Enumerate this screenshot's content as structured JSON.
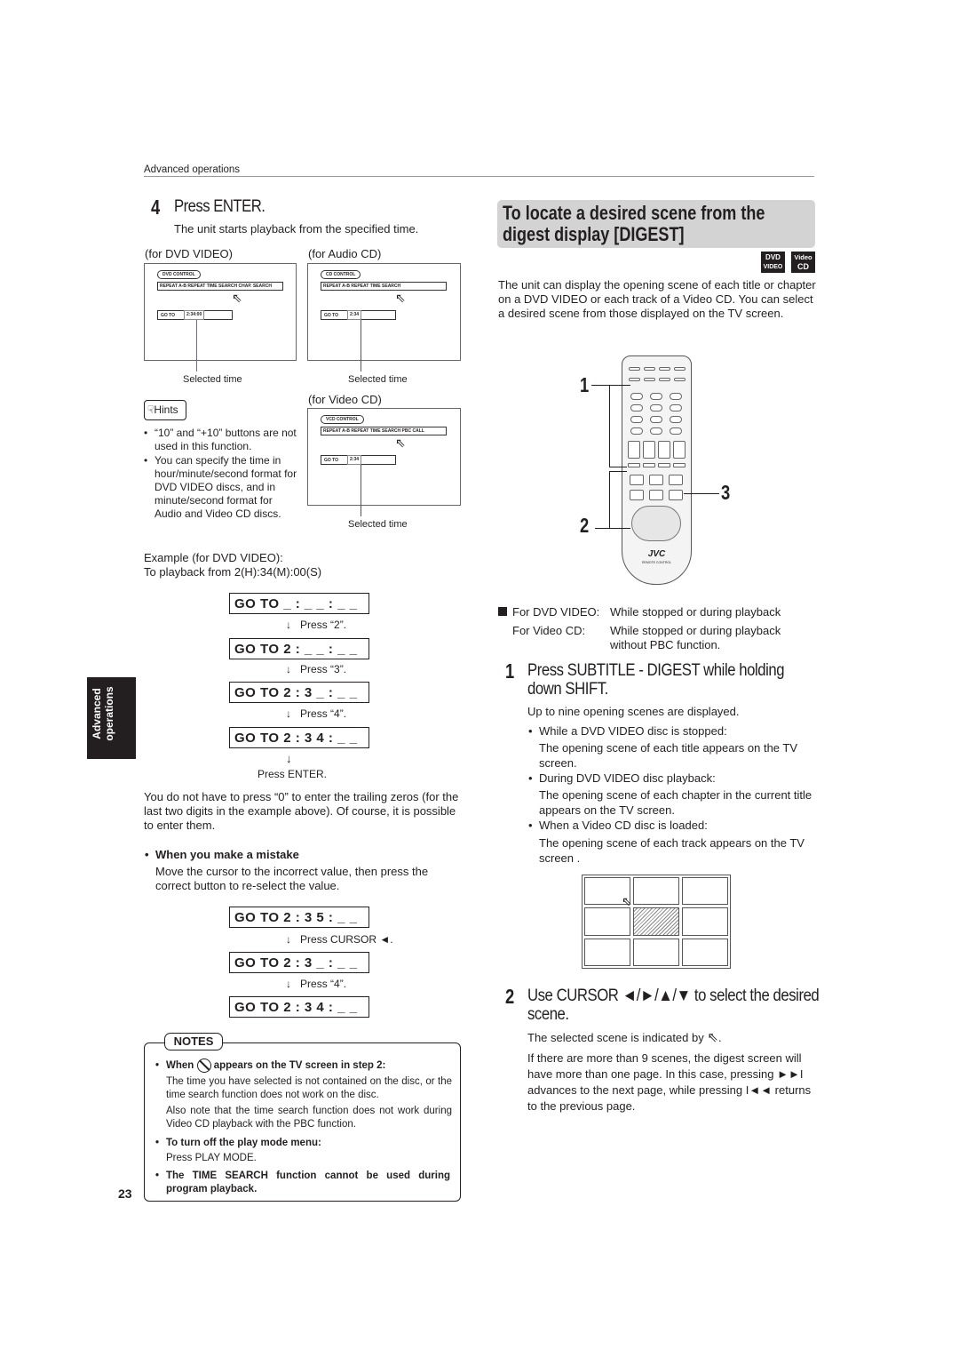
{
  "header": {
    "section": "Advanced operations"
  },
  "step4": {
    "number": "4",
    "title": "Press ENTER.",
    "desc": "The unit starts playback from the specified time."
  },
  "screens": {
    "dvd": {
      "label": "(for DVD VIDEO)",
      "control": "DVD CONTROL",
      "menu": "REPEAT   A-B REPEAT   TIME SEARCH   CHAP. SEARCH",
      "goto": "GO TO",
      "value": "2:34:00",
      "caption": "Selected time"
    },
    "audio": {
      "label": "(for Audio CD)",
      "control": "CD CONTROL",
      "menu": "REPEAT   A-B REPEAT   TIME SEARCH",
      "goto": "GO TO",
      "value": "2:34",
      "caption": "Selected time"
    },
    "vcd": {
      "label": "(for Video CD)",
      "control": "VCD CONTROL",
      "menu": "REPEAT   A-B REPEAT   TIME SEARCH   PBC CALL",
      "goto": "GO TO",
      "value": "2:34",
      "caption": "Selected time"
    }
  },
  "hints": {
    "title": "Hints",
    "items": [
      "“10” and “+10” buttons are not used in this function.",
      "You can specify the time in hour/minute/second format for DVD VIDEO discs, and in minute/second format for Audio and Video CD discs."
    ]
  },
  "example": {
    "line1": "Example (for DVD VIDEO):",
    "line2": "To playback from 2(H):34(M):00(S)",
    "sequence": [
      "GO TO   _ : _ _ : _ _",
      "GO TO   2 : _ _ : _ _",
      "GO TO   2 : 3 _ : _ _",
      "GO TO   2 : 3 4 : _ _"
    ],
    "presses": [
      "Press “2”.",
      "Press “3”.",
      "Press “4”.",
      "Press ENTER."
    ]
  },
  "trailing_note": "You do not have to press “0” to enter the trailing zeros (for the last two digits in the example above). Of course, it is possible to enter them.",
  "mistake": {
    "title": "When you make a mistake",
    "desc": "Move the cursor to the incorrect value, then press the correct button to re-select the value.",
    "sequence": [
      "GO TO   2 :  3 5  : _ _",
      "GO TO   2 :  3 _  : _ _",
      "GO TO   2 :  3 4  : _ _"
    ],
    "presses": [
      "Press CURSOR ◄.",
      "Press “4”."
    ]
  },
  "notes": {
    "title": "NOTES",
    "items": [
      {
        "head_pre": "When",
        "head_post": "appears on the TV screen in step 2:",
        "body": [
          "The time you have selected is not contained on the disc, or the time search function does not work on the disc.",
          "Also note that the time search function does not work during Video CD playback with the PBC function."
        ]
      },
      {
        "head": "To turn off the play mode menu:",
        "body": [
          "Press PLAY MODE."
        ]
      },
      {
        "head": "The TIME SEARCH function cannot be used during program playback.",
        "body": []
      }
    ]
  },
  "side_tab": {
    "line1": "Advanced",
    "line2": "operations"
  },
  "page_number": "23",
  "digest": {
    "title": "To locate a desired scene from the digest display [DIGEST]",
    "badges": {
      "dvd_top": "DVD",
      "dvd_bottom": "VIDEO",
      "vcd_top": "Video",
      "vcd_bottom": "CD"
    },
    "intro": "The unit can display the opening scene of each title or chapter on a DVD VIDEO or each track of a Video CD. You can select a desired scene from those displayed on the TV screen.",
    "remote": {
      "brand": "JVC",
      "caption": "REMOTE CONTROL",
      "callouts": [
        "1",
        "2",
        "3"
      ]
    },
    "conditions": [
      {
        "label": "For DVD VIDEO:",
        "text": "While stopped or during playback"
      },
      {
        "label": "For Video CD:",
        "text": "While stopped or during playback without PBC function."
      }
    ],
    "step1": {
      "number": "1",
      "title": "Press SUBTITLE - DIGEST while holding down SHIFT.",
      "desc": "Up to nine opening scenes are displayed.",
      "items": [
        {
          "head": "While a DVD VIDEO disc is stopped:",
          "body": "The opening scene of each title appears on the TV screen."
        },
        {
          "head": "During DVD VIDEO disc playback:",
          "body": "The opening scene of each chapter in the current title appears on the TV screen."
        },
        {
          "head": "When a Video CD disc is loaded:",
          "body": "The opening scene of each track appears on the TV screen ."
        }
      ]
    },
    "step2": {
      "number": "2",
      "title": "Use CURSOR ◄/►/▲/▼ to select the desired scene.",
      "desc_pre": "The selected scene is indicated by",
      "desc_post": ".",
      "more": "If there are more than 9 scenes, the digest screen will have more than one page. In this case, pressing ►►I advances to the next page, while pressing I◄◄ returns to the previous page."
    }
  },
  "colors": {
    "title_box": "#d3d3d3",
    "side_tab": "#231f20",
    "leader": "#6a6f9a"
  }
}
